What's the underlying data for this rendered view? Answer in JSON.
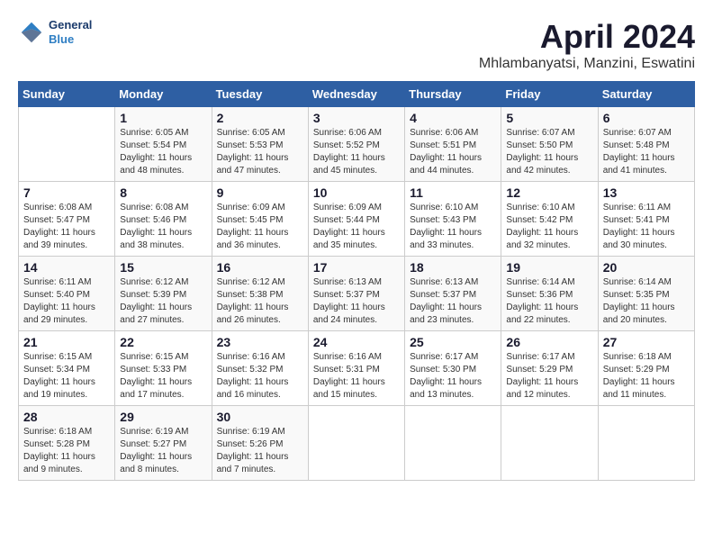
{
  "header": {
    "logo_line1": "General",
    "logo_line2": "Blue",
    "title": "April 2024",
    "location": "Mhlambanyatsi, Manzini, Eswatini"
  },
  "weekdays": [
    "Sunday",
    "Monday",
    "Tuesday",
    "Wednesday",
    "Thursday",
    "Friday",
    "Saturday"
  ],
  "weeks": [
    [
      {
        "day": "",
        "info": ""
      },
      {
        "day": "1",
        "info": "Sunrise: 6:05 AM\nSunset: 5:54 PM\nDaylight: 11 hours\nand 48 minutes."
      },
      {
        "day": "2",
        "info": "Sunrise: 6:05 AM\nSunset: 5:53 PM\nDaylight: 11 hours\nand 47 minutes."
      },
      {
        "day": "3",
        "info": "Sunrise: 6:06 AM\nSunset: 5:52 PM\nDaylight: 11 hours\nand 45 minutes."
      },
      {
        "day": "4",
        "info": "Sunrise: 6:06 AM\nSunset: 5:51 PM\nDaylight: 11 hours\nand 44 minutes."
      },
      {
        "day": "5",
        "info": "Sunrise: 6:07 AM\nSunset: 5:50 PM\nDaylight: 11 hours\nand 42 minutes."
      },
      {
        "day": "6",
        "info": "Sunrise: 6:07 AM\nSunset: 5:48 PM\nDaylight: 11 hours\nand 41 minutes."
      }
    ],
    [
      {
        "day": "7",
        "info": "Sunrise: 6:08 AM\nSunset: 5:47 PM\nDaylight: 11 hours\nand 39 minutes."
      },
      {
        "day": "8",
        "info": "Sunrise: 6:08 AM\nSunset: 5:46 PM\nDaylight: 11 hours\nand 38 minutes."
      },
      {
        "day": "9",
        "info": "Sunrise: 6:09 AM\nSunset: 5:45 PM\nDaylight: 11 hours\nand 36 minutes."
      },
      {
        "day": "10",
        "info": "Sunrise: 6:09 AM\nSunset: 5:44 PM\nDaylight: 11 hours\nand 35 minutes."
      },
      {
        "day": "11",
        "info": "Sunrise: 6:10 AM\nSunset: 5:43 PM\nDaylight: 11 hours\nand 33 minutes."
      },
      {
        "day": "12",
        "info": "Sunrise: 6:10 AM\nSunset: 5:42 PM\nDaylight: 11 hours\nand 32 minutes."
      },
      {
        "day": "13",
        "info": "Sunrise: 6:11 AM\nSunset: 5:41 PM\nDaylight: 11 hours\nand 30 minutes."
      }
    ],
    [
      {
        "day": "14",
        "info": "Sunrise: 6:11 AM\nSunset: 5:40 PM\nDaylight: 11 hours\nand 29 minutes."
      },
      {
        "day": "15",
        "info": "Sunrise: 6:12 AM\nSunset: 5:39 PM\nDaylight: 11 hours\nand 27 minutes."
      },
      {
        "day": "16",
        "info": "Sunrise: 6:12 AM\nSunset: 5:38 PM\nDaylight: 11 hours\nand 26 minutes."
      },
      {
        "day": "17",
        "info": "Sunrise: 6:13 AM\nSunset: 5:37 PM\nDaylight: 11 hours\nand 24 minutes."
      },
      {
        "day": "18",
        "info": "Sunrise: 6:13 AM\nSunset: 5:37 PM\nDaylight: 11 hours\nand 23 minutes."
      },
      {
        "day": "19",
        "info": "Sunrise: 6:14 AM\nSunset: 5:36 PM\nDaylight: 11 hours\nand 22 minutes."
      },
      {
        "day": "20",
        "info": "Sunrise: 6:14 AM\nSunset: 5:35 PM\nDaylight: 11 hours\nand 20 minutes."
      }
    ],
    [
      {
        "day": "21",
        "info": "Sunrise: 6:15 AM\nSunset: 5:34 PM\nDaylight: 11 hours\nand 19 minutes."
      },
      {
        "day": "22",
        "info": "Sunrise: 6:15 AM\nSunset: 5:33 PM\nDaylight: 11 hours\nand 17 minutes."
      },
      {
        "day": "23",
        "info": "Sunrise: 6:16 AM\nSunset: 5:32 PM\nDaylight: 11 hours\nand 16 minutes."
      },
      {
        "day": "24",
        "info": "Sunrise: 6:16 AM\nSunset: 5:31 PM\nDaylight: 11 hours\nand 15 minutes."
      },
      {
        "day": "25",
        "info": "Sunrise: 6:17 AM\nSunset: 5:30 PM\nDaylight: 11 hours\nand 13 minutes."
      },
      {
        "day": "26",
        "info": "Sunrise: 6:17 AM\nSunset: 5:29 PM\nDaylight: 11 hours\nand 12 minutes."
      },
      {
        "day": "27",
        "info": "Sunrise: 6:18 AM\nSunset: 5:29 PM\nDaylight: 11 hours\nand 11 minutes."
      }
    ],
    [
      {
        "day": "28",
        "info": "Sunrise: 6:18 AM\nSunset: 5:28 PM\nDaylight: 11 hours\nand 9 minutes."
      },
      {
        "day": "29",
        "info": "Sunrise: 6:19 AM\nSunset: 5:27 PM\nDaylight: 11 hours\nand 8 minutes."
      },
      {
        "day": "30",
        "info": "Sunrise: 6:19 AM\nSunset: 5:26 PM\nDaylight: 11 hours\nand 7 minutes."
      },
      {
        "day": "",
        "info": ""
      },
      {
        "day": "",
        "info": ""
      },
      {
        "day": "",
        "info": ""
      },
      {
        "day": "",
        "info": ""
      }
    ]
  ]
}
